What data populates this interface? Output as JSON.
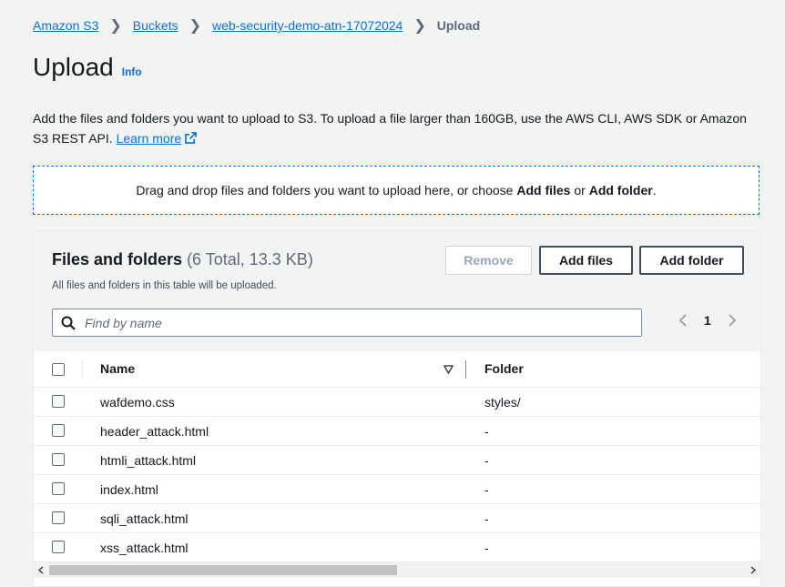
{
  "breadcrumb": {
    "items": [
      "Amazon S3",
      "Buckets",
      "web-security-demo-atn-17072024"
    ],
    "current": "Upload"
  },
  "page": {
    "title": "Upload",
    "info": "Info",
    "description": "Add the files and folders you want to upload to S3. To upload a file larger than 160GB, use the AWS CLI, AWS SDK or Amazon S3 REST API.",
    "learn_more": "Learn more"
  },
  "dropzone": {
    "prefix": "Drag and drop files and folders you want to upload here, or choose",
    "add_files": "Add files",
    "or": "or",
    "add_folder": "Add folder",
    "suffix": "."
  },
  "files_panel": {
    "title": "Files and folders",
    "count": "(6 Total, 13.3 KB)",
    "subtitle": "All files and folders in this table will be uploaded.",
    "remove_label": "Remove",
    "add_files_label": "Add files",
    "add_folder_label": "Add folder",
    "search_placeholder": "Find by name",
    "page_number": "1",
    "columns": {
      "name": "Name",
      "folder": "Folder"
    },
    "rows": [
      {
        "name": "wafdemo.css",
        "folder": "styles/"
      },
      {
        "name": "header_attack.html",
        "folder": "-"
      },
      {
        "name": "htmli_attack.html",
        "folder": "-"
      },
      {
        "name": "index.html",
        "folder": "-"
      },
      {
        "name": "sqli_attack.html",
        "folder": "-"
      },
      {
        "name": "xss_attack.html",
        "folder": "-"
      }
    ]
  },
  "colors": {
    "link": "#0972d3",
    "text": "#16191f",
    "muted": "#5f6b7a",
    "background": "#f2f3f3"
  }
}
